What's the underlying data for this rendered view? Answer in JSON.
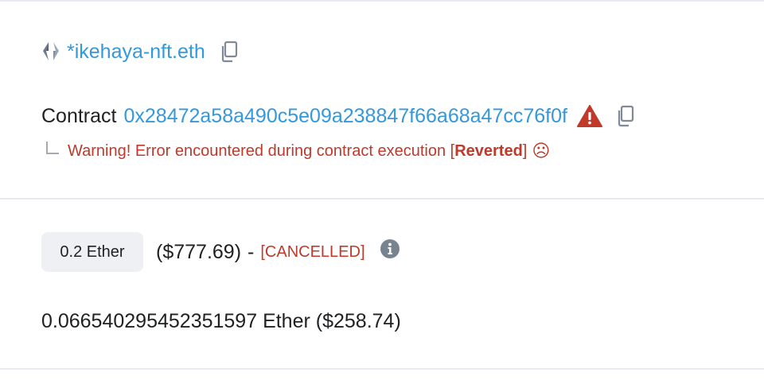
{
  "ens": {
    "name": "*ikehaya-nft.eth"
  },
  "contract": {
    "label": "Contract",
    "address": "0x28472a58a490c5e09a238847f66a68a47cc76f0f"
  },
  "warning": {
    "prefix": "Warning! Error encountered during contract execution [",
    "status": "Reverted",
    "suffix": "]",
    "emoji": "☹"
  },
  "value": {
    "amount": "0.2 Ether",
    "usd": "($777.69)",
    "separator": "-",
    "status": "[CANCELLED]"
  },
  "fee": {
    "text": "0.06654029545235159​7 Ether ($258.74)"
  },
  "colors": {
    "link": "#3498db",
    "error": "#c0392b",
    "text": "#1e2022",
    "badge_bg": "#eef0f3",
    "divider": "#e7eaf3"
  }
}
